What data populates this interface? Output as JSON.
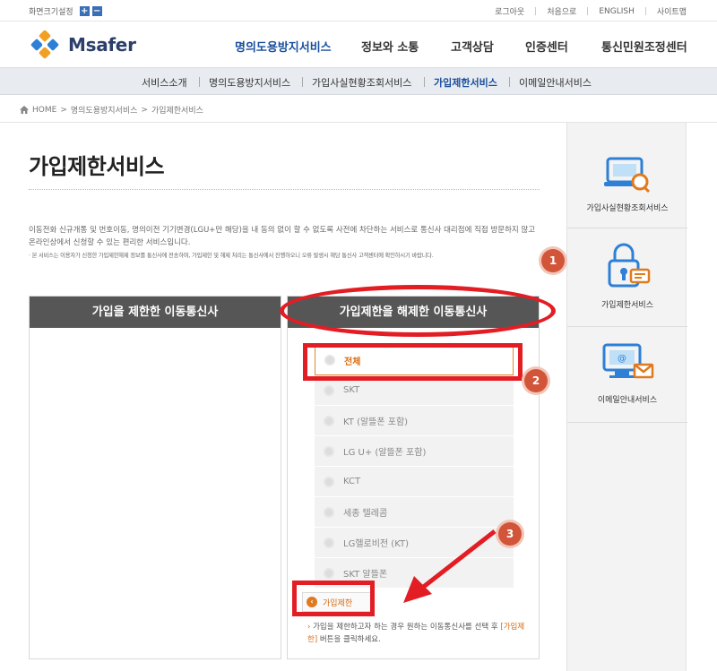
{
  "util": {
    "font_size_label": "화면크기설정",
    "plus": "+",
    "minus": "−",
    "links": [
      "로그아웃",
      "처음으로",
      "ENGLISH",
      "사이트맵"
    ]
  },
  "logo": {
    "text": "Msafer"
  },
  "gnb": [
    "명의도용방지서비스",
    "정보와 소통",
    "고객상담",
    "인증센터",
    "통신민원조정센터"
  ],
  "subnav": [
    "서비스소개",
    "명의도용방지서비스",
    "가입사실현황조회서비스",
    "가입제한서비스",
    "이메일안내서비스"
  ],
  "breadcrumb": {
    "home": "HOME",
    "sep": ">",
    "level1": "명의도용방지서비스",
    "level2": "가입제한서비스"
  },
  "title": "가입제한서비스",
  "desc": "이동전화 신규개통 및 번호이동, 명의이전 기기변경(LGU+만 해당)을 내 동의 없이 할 수 없도록 사전에 차단하는 서비스로 통신사 대리점에 직접 방문하지 않고 온라인상에서 신청할 수 있는 편리한 서비스입니다.",
  "note": "· 본 서비스는 이용자가 신청한 가입제한해제 정보를 통신사에 전송하며, 가입제한 및 해제 처리는 통신사에서 진행하오니 오류 발생시 해당 통신사 고객센터에 확인하시기 바랍니다.",
  "panels": {
    "left_title": "가입을 제한한 이동통신사",
    "right_title": "가입제한을 해제한 이동통신사"
  },
  "options": [
    "전체",
    "SKT",
    "KT (알뜰폰 포함)",
    "LG U+ (알뜰폰 포함)",
    "KCT",
    "세종 텔레콤",
    "LG헬로비전 (KT)",
    "SKT 알뜰폰"
  ],
  "button": {
    "join_restrict": "가입제한"
  },
  "tip": {
    "before": "가입을 제한하고자 하는 경우 원하는 이동통신사를 선택 후",
    "bracket": "[가입제한]",
    "after": " 버튼을 클릭하세요."
  },
  "sidebar": [
    "가입사실현황조회서비스",
    "가입제한서비스",
    "이메일안내서비스"
  ],
  "badges": [
    "1",
    "2",
    "3"
  ],
  "colors": {
    "accent": "#1a4f9c",
    "annotation": "#e31d24",
    "orange": "#d86a10"
  }
}
